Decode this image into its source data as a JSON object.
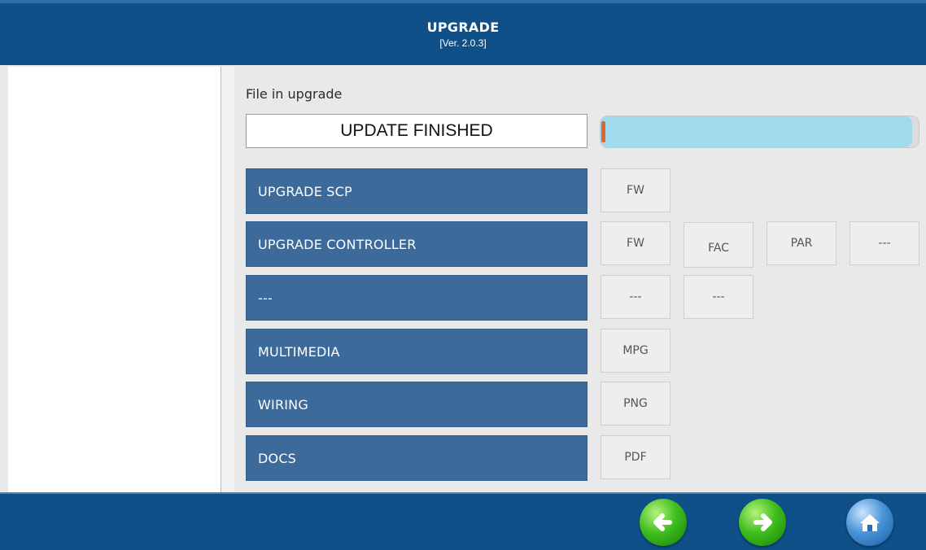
{
  "header": {
    "title": "UPGRADE",
    "version": "[Ver. 2.0.3]"
  },
  "file_section": {
    "label": "File in upgrade",
    "value": "UPDATE FINISHED"
  },
  "progress": {
    "fraction": 0.98,
    "fill_color": "#9fdbea"
  },
  "rows": [
    {
      "label": "UPGRADE SCP",
      "buttons": [
        "FW"
      ]
    },
    {
      "label": "UPGRADE CONTROLLER",
      "buttons": [
        "FW",
        "FAC",
        "PAR",
        "---"
      ]
    },
    {
      "label": "---",
      "buttons": [
        "---",
        "---"
      ]
    },
    {
      "label": "MULTIMEDIA",
      "buttons": [
        "MPG"
      ]
    },
    {
      "label": "WIRING",
      "buttons": [
        "PNG"
      ]
    },
    {
      "label": "DOCS",
      "buttons": [
        "PDF"
      ]
    }
  ],
  "footer": {
    "icons": [
      "back-arrow-icon",
      "forward-arrow-icon",
      "home-icon"
    ]
  },
  "colors": {
    "header_bg": "#0f5089",
    "row_button_bg": "#3c6a9b",
    "accent_green": "#3fbf1c",
    "accent_blue": "#4a95d8"
  }
}
